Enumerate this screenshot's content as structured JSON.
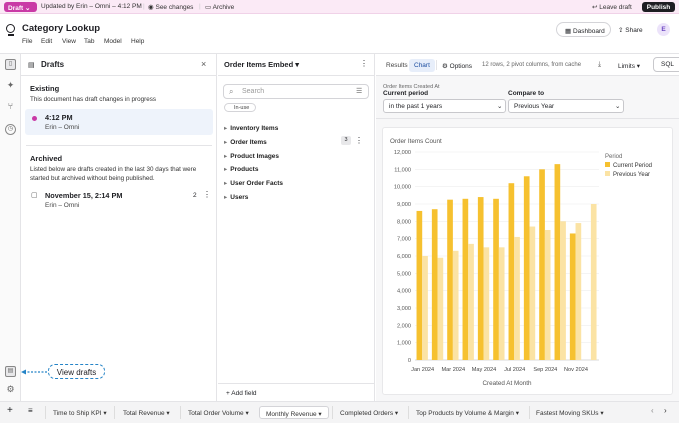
{
  "topbar": {
    "draft_label": "Draft",
    "updated_text": "Updated by Erin – Omni – 4:12 PM",
    "see_changes": "See changes",
    "archive": "Archive",
    "leave_draft": "Leave draft",
    "publish": "Publish"
  },
  "header": {
    "title": "Category Lookup",
    "menu": [
      "File",
      "Edit",
      "View",
      "Tab",
      "Model",
      "Help"
    ],
    "dashboard": "Dashboard",
    "share": "Share",
    "avatar": "E"
  },
  "drafts": {
    "title": "Drafts",
    "existing_heading": "Existing",
    "existing_desc": "This document has draft changes in progress",
    "existing_item": {
      "time": "4:12 PM",
      "author": "Erin – Omni"
    },
    "archived_heading": "Archived",
    "archived_desc_1": "Listed below are drafts created in the last 30 days that were",
    "archived_desc_2": "started but archived without being published.",
    "archived_item": {
      "time": "November 15, 2:14 PM",
      "author": "Erin – Omni",
      "count": "2"
    }
  },
  "embed": {
    "title": "Order Items Embed",
    "search_placeholder": "Search",
    "in_use": "In-use",
    "fields": [
      "Inventory Items",
      "Order Items",
      "Product Images",
      "Products",
      "User Order Facts",
      "Users"
    ],
    "order_items_count": "3",
    "add_field": "Add field"
  },
  "results": {
    "tab_results": "Results",
    "tab_chart": "Chart",
    "options": "Options",
    "info": "12 rows, 2 pivot columns, from cache",
    "limits": "Limits",
    "sql": "SQL",
    "filter_caption": "Order Items Created At",
    "current_period_label": "Current period",
    "current_period_value": "in the past 1 years",
    "compare_label": "Compare to",
    "compare_value": "Previous Year"
  },
  "colors": {
    "current": "#f6c12f",
    "previous": "#fbe3a4",
    "accent": "#c93aa6",
    "callout": "#2584c7"
  },
  "chart_data": {
    "type": "bar",
    "ylabel": "Order Items Count",
    "xlabel": "Created At Month",
    "ylim": [
      0,
      12000
    ],
    "yticks": [
      "0",
      "1,000",
      "2,000",
      "3,000",
      "4,000",
      "5,000",
      "6,000",
      "7,000",
      "8,000",
      "9,000",
      "10,000",
      "11,000",
      "12,000"
    ],
    "categories": [
      "Jan 2024",
      "Feb 2024",
      "Mar 2024",
      "Apr 2024",
      "May 2024",
      "Jun 2024",
      "Jul 2024",
      "Aug 2024",
      "Sep 2024",
      "Oct 2024",
      "Nov 2024",
      "Dec 2024"
    ],
    "xtick_labels": [
      "Jan 2024",
      "Mar 2024",
      "May 2024",
      "Jul 2024",
      "Sep 2024",
      "Nov 2024"
    ],
    "legend_title": "Period",
    "legend_placement": "top-right",
    "series": [
      {
        "name": "Current Period",
        "values": [
          8600,
          8700,
          9250,
          9300,
          9400,
          9300,
          10200,
          10600,
          11000,
          11300,
          7300,
          null
        ]
      },
      {
        "name": "Previous Year",
        "values": [
          6000,
          5900,
          6300,
          6700,
          6500,
          6500,
          7100,
          7700,
          7500,
          8000,
          7900,
          9000
        ]
      }
    ]
  },
  "bottom_tabs": [
    "Time to Ship KPI",
    "Total Revenue",
    "Total Order Volume",
    "Monthly Revenue",
    "Completed Orders",
    "Top Products by Volume & Margin",
    "Fastest Moving SKUs"
  ],
  "callout": "View drafts"
}
